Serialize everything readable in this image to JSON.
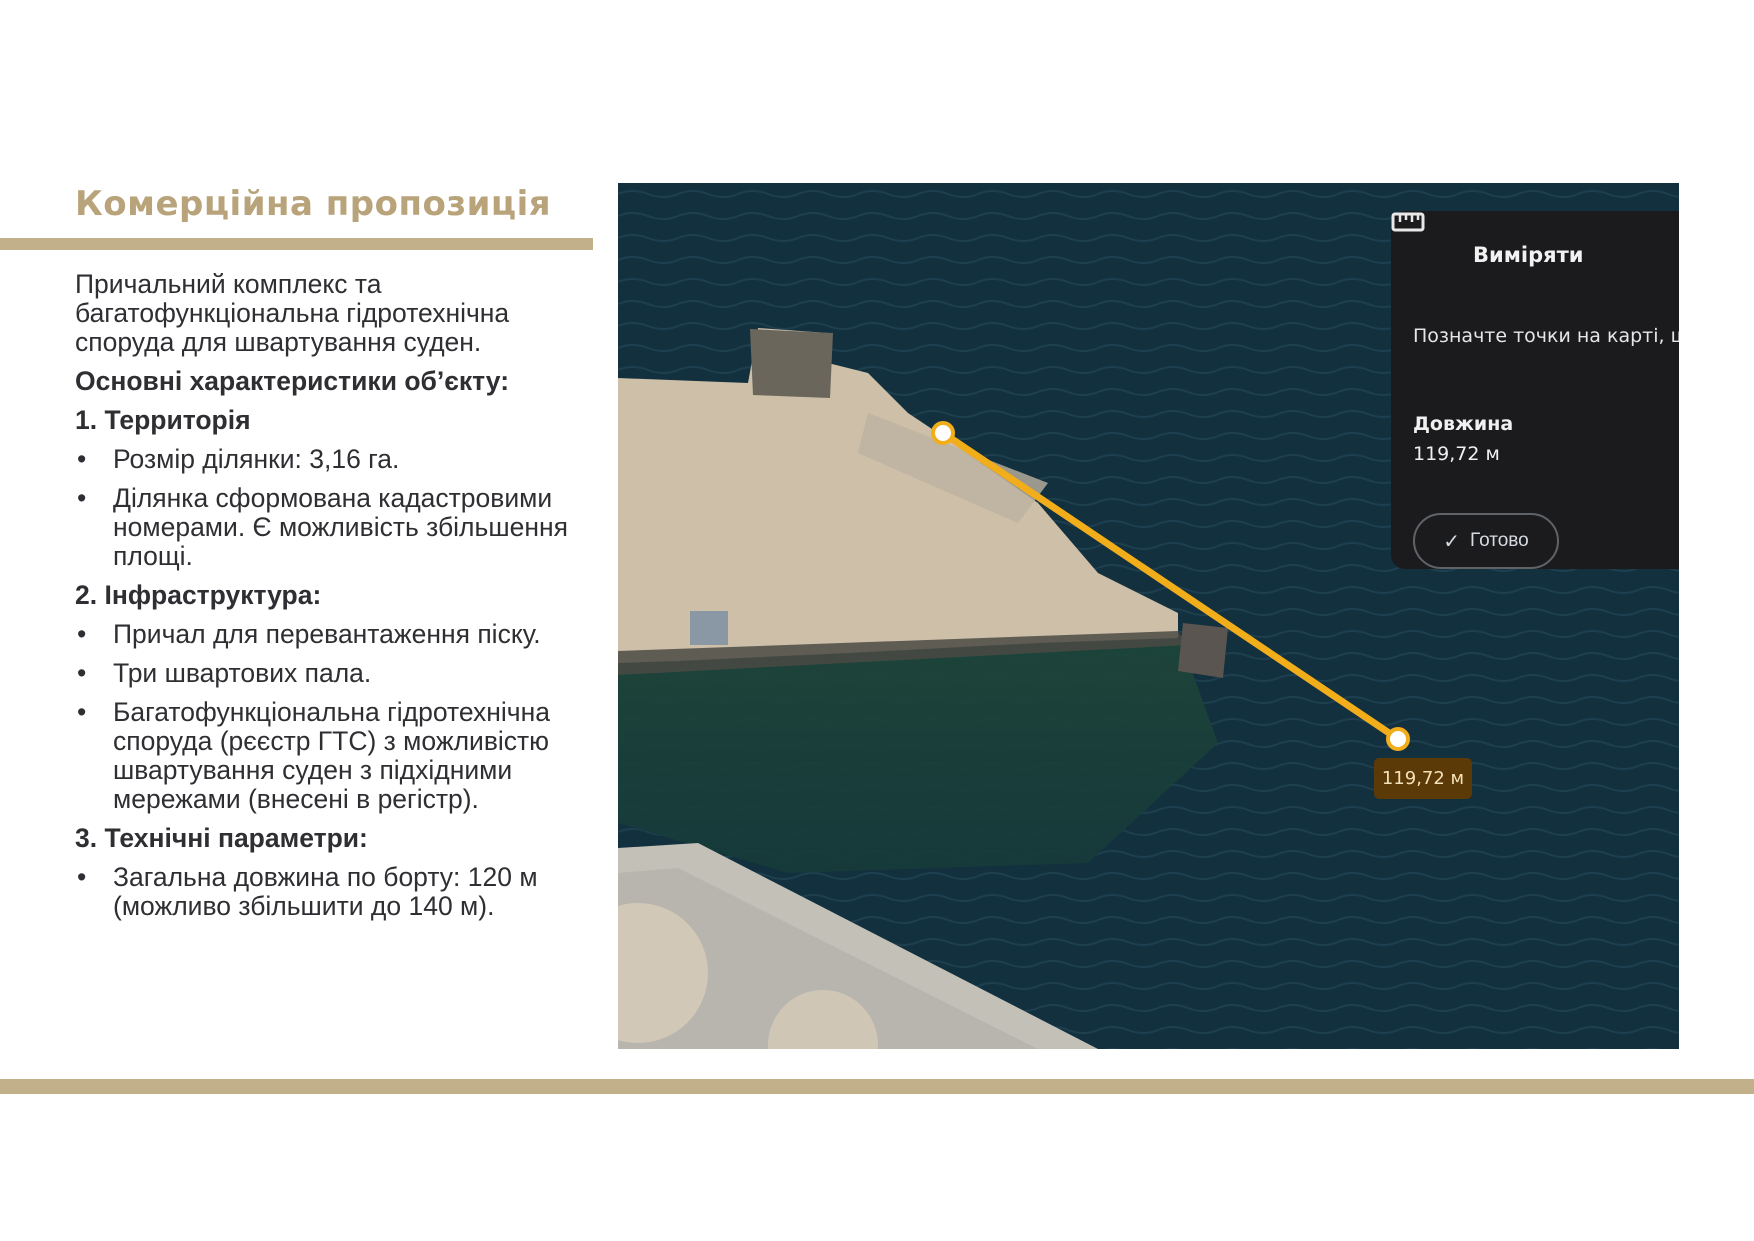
{
  "slide": {
    "title": "Комерційна пропозиція",
    "intro": "Причальний комплекс та багатофункціональна гідротехнічна споруда для швартування суден.",
    "characteristics_heading": "Основні характеристики об’єкту:",
    "sections": [
      {
        "heading": "1. Территорія",
        "bullets": [
          "Розмір ділянки: 3,16 га.",
          "Ділянка сформована кадастровими номерами. Є можливість збільшення площі."
        ]
      },
      {
        "heading": "2. Інфраструктура:",
        "bullets": [
          "Причал для перевантаження піску.",
          "Три швартових пала.",
          "Багатофункціональна гідротехнічна споруда (рєєстр ГТС) з можливістю швартування суден з підхідними мережами (внесені в регістр)."
        ]
      },
      {
        "heading": "3. Технічні параметри:",
        "bullets": [
          "Загальна довжина по борту: 120 м (можливо збільшити до 140 м)."
        ]
      }
    ],
    "bullet_glyph": "•"
  },
  "map": {
    "measure_panel": {
      "icon": "ruler-icon",
      "title": "Виміряти",
      "hint": "Позначте точки на карті, щ площу",
      "length_label": "Довжина",
      "length_value": "119,72 м",
      "done_label": "Готово",
      "done_icon": "check-icon"
    },
    "distance_label": "119,72 м",
    "colors": {
      "measure_line": "#f2ad1b",
      "water": "#13303e",
      "sand": "#cdbfa8",
      "panel": "#1b1b1d"
    }
  },
  "colors": {
    "accent": "#c2b08a",
    "title": "#b8a37a",
    "text": "#2f2f33"
  }
}
